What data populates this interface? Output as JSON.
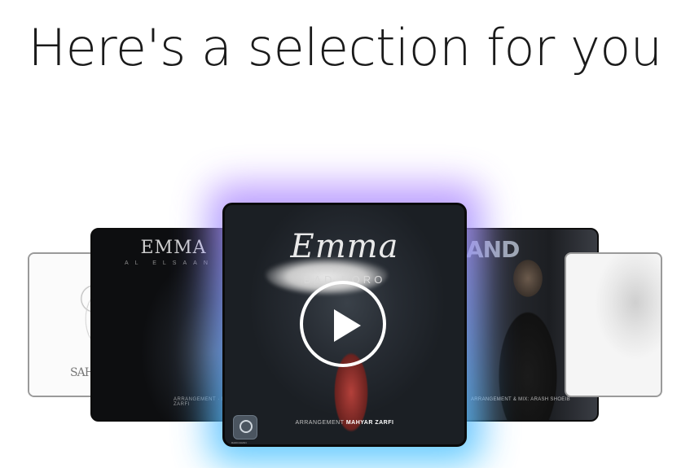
{
  "header": {
    "title": "Here's a selection for you"
  },
  "carousel": {
    "cards": [
      {
        "position": "far-left",
        "text": "SAH"
      },
      {
        "position": "left",
        "title": "EMMA",
        "subtitle": "AL ELSAAN",
        "credit": "ARRANGEMENT · MAHYAR ZARFI"
      },
      {
        "position": "center",
        "title": "Emma",
        "subtitle": "BAD BORO",
        "credit_label": "ARRANGEMENT",
        "credit_name": "MAHYAR ZARFI",
        "badge_label": "RADIOJAVAN",
        "action_icon": "play-icon"
      },
      {
        "position": "right",
        "title": "AND",
        "credit": "ARRANGEMENT & MIX: ARASH SHOEIB"
      },
      {
        "position": "far-right"
      }
    ]
  },
  "colors": {
    "glow_top": "#b98cff",
    "glow_bottom": "#46c8ff",
    "card_border": "#0a0a0a",
    "title": "#1a1a1a"
  }
}
